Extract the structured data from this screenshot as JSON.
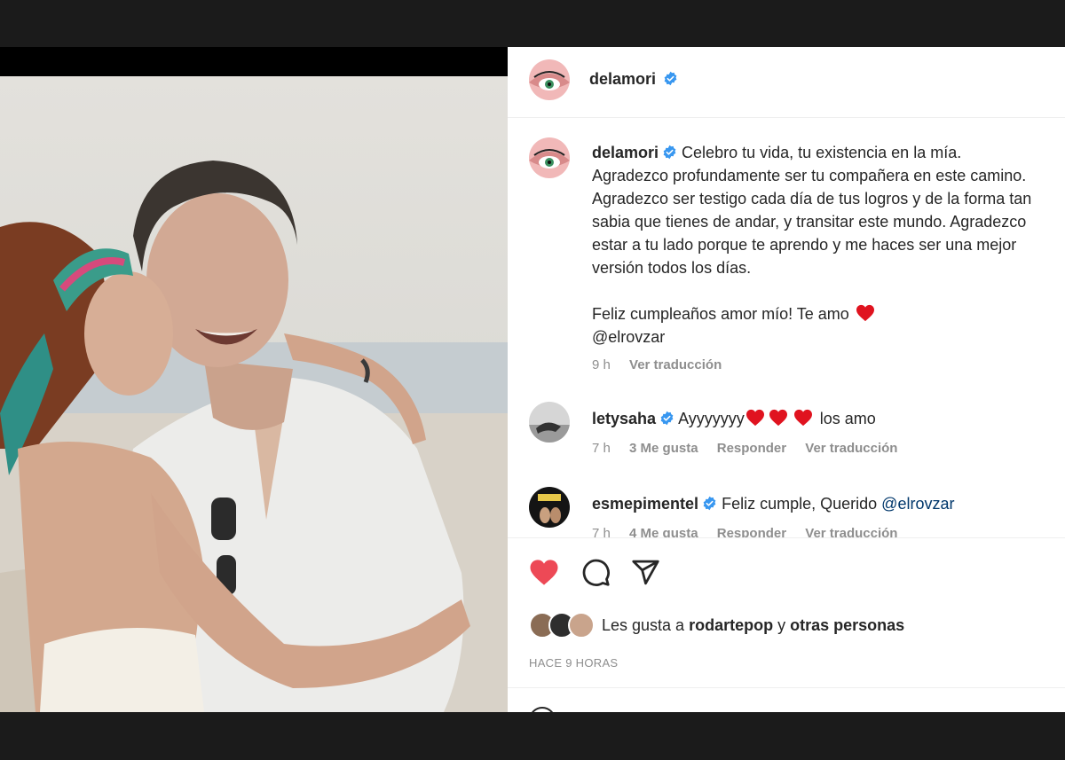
{
  "post": {
    "author": "delamori",
    "caption_lines": [
      "Celebro tu vida, tu existencia en la mía.",
      "Agradezco profundamente ser tu compañera en este camino.",
      "Agradezco ser testigo cada día de tus logros y de la forma tan",
      "sabia que tienes de andar, y transitar este mundo. Agradezco",
      "estar a tu lado porque te aprendo y me haces ser una mejor",
      "versión todos los días."
    ],
    "caption_closing": "Feliz cumpleaños amor mío! Te amo",
    "caption_mention": "@elrovzar",
    "caption_time": "9 h",
    "caption_translate": "Ver traducción"
  },
  "comments": [
    {
      "user": "letysaha",
      "text_before": "Ayyyyyyy",
      "text_after": "los amo",
      "time": "7 h",
      "likes": "3 Me gusta",
      "reply": "Responder",
      "translate": "Ver traducción"
    },
    {
      "user": "esmepimentel",
      "text_before": "Feliz cumple, Querido",
      "mention": "@elrovzar",
      "time": "7 h",
      "likes": "4 Me gusta",
      "reply": "Responder",
      "translate": "Ver traducción"
    }
  ],
  "engagement": {
    "liked_by_prefix": "Les gusta a",
    "liked_by_user": "rodartepop",
    "liked_by_joiner": "y",
    "liked_by_others": "otras personas",
    "time_ago": "HACE 9 HORAS"
  },
  "icons": {
    "like": "heart-filled-icon",
    "comment": "comment-bubble-icon",
    "share": "paper-plane-icon",
    "verified": "verified-badge-icon"
  },
  "colors": {
    "heart": "#ed4956",
    "verified": "#3897f0",
    "link": "#00376b",
    "muted": "#8e8e8e"
  }
}
